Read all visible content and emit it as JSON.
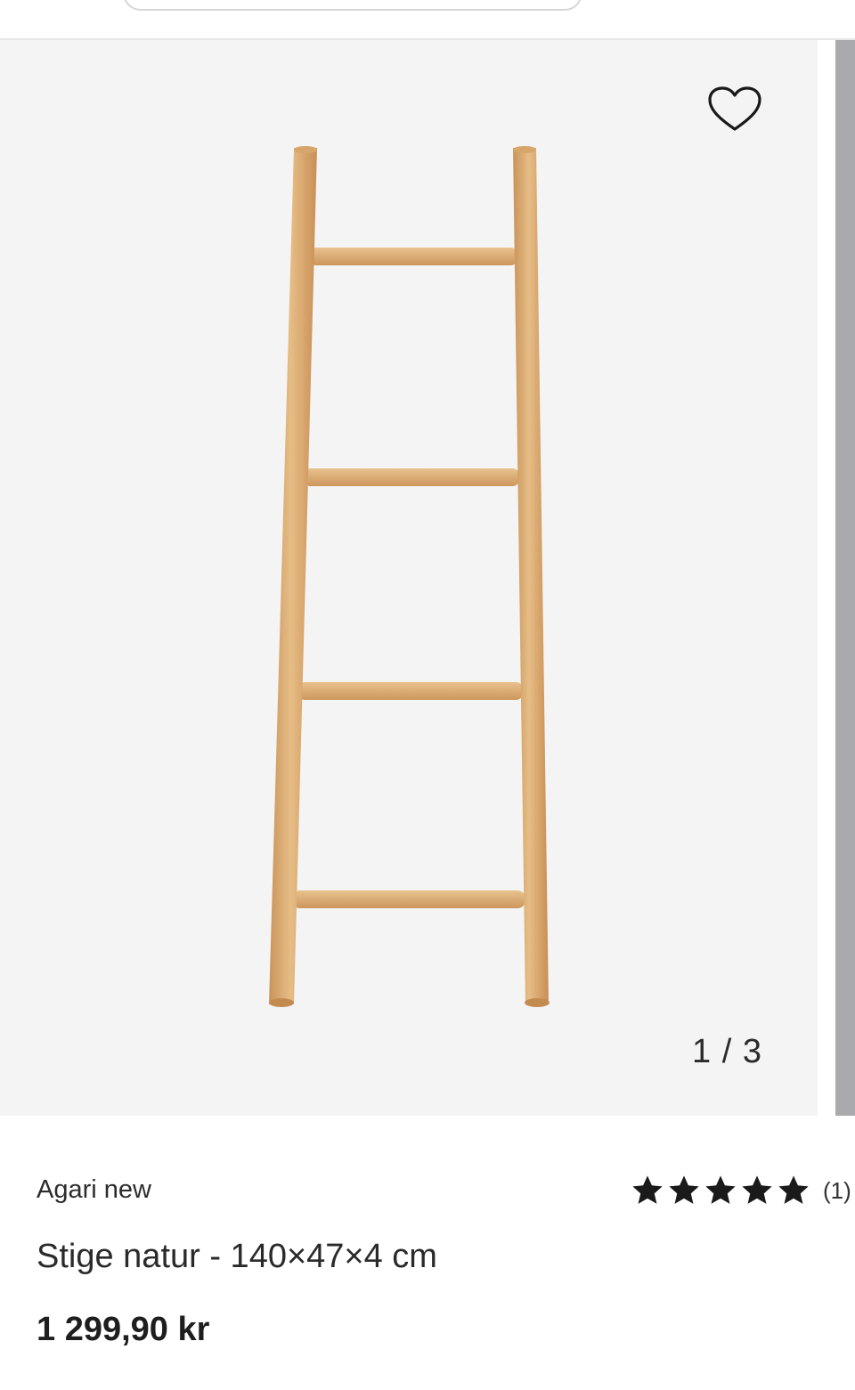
{
  "gallery": {
    "counter": "1 / 3"
  },
  "product": {
    "brand": "Agari new",
    "title": "Stige natur - 140×47×4 cm",
    "price": "1 299,90 kr",
    "rating": {
      "stars": 5,
      "review_count": "(1)"
    }
  },
  "icons": {
    "favorite": "heart-outline-icon",
    "rating": "star-icon"
  },
  "colors": {
    "gallery_bg": "#f4f4f4",
    "wood": "#dcae74",
    "star": "#1a1a1a"
  }
}
